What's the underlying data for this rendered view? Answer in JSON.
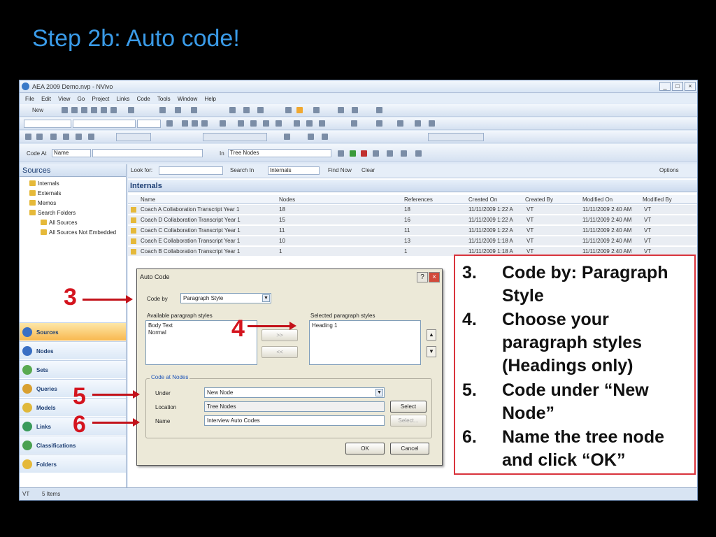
{
  "slide": {
    "title": "Step 2b: Auto code!"
  },
  "window": {
    "title": "AEA 2009 Demo.nvp - NVivo",
    "min": "_",
    "max": "□",
    "close": "×"
  },
  "menu": [
    "File",
    "Edit",
    "View",
    "Go",
    "Project",
    "Links",
    "Code",
    "Tools",
    "Window",
    "Help"
  ],
  "toolbar": {
    "new_label": "New",
    "code_at_label": "Code At",
    "code_at_value": "Name",
    "in_label": "In",
    "in_value": "Tree Nodes"
  },
  "sidebar": {
    "title": "Sources",
    "tree": [
      "Internals",
      "Externals",
      "Memos",
      "Search Folders",
      "All Sources",
      "All Sources Not Embedded"
    ],
    "nav": [
      "Sources",
      "Nodes",
      "Sets",
      "Queries",
      "Models",
      "Links",
      "Classifications",
      "Folders"
    ]
  },
  "findbar": {
    "look_for": "Look for:",
    "search_in": "Search In",
    "search_in_value": "Internals",
    "find_now": "Find Now",
    "clear": "Clear",
    "options": "Options"
  },
  "list": {
    "title": "Internals",
    "columns": [
      "Name",
      "Nodes",
      "References",
      "Created On",
      "Created By",
      "Modified On",
      "Modified By"
    ],
    "rows": [
      [
        "Coach A Collaboration Transcript Year 1",
        "18",
        "18",
        "11/11/2009 1:22 A",
        "VT",
        "11/11/2009 2:40 AM",
        "VT"
      ],
      [
        "Coach D Collaboration Transcript Year 1",
        "15",
        "16",
        "11/11/2009 1:22 A",
        "VT",
        "11/11/2009 2:40 AM",
        "VT"
      ],
      [
        "Coach C Collaboration Transcript Year 1",
        "11",
        "11",
        "11/11/2009 1:22 A",
        "VT",
        "11/11/2009 2:40 AM",
        "VT"
      ],
      [
        "Coach E Collaboration Transcript Year 1",
        "10",
        "13",
        "11/11/2009 1:18 A",
        "VT",
        "11/11/2009 2:40 AM",
        "VT"
      ],
      [
        "Coach B Collaboration Transcript Year 1",
        "1",
        "1",
        "11/11/2009 1:18 A",
        "VT",
        "11/11/2009 2:40 AM",
        "VT"
      ]
    ]
  },
  "dialog": {
    "title": "Auto Code",
    "help": "?",
    "close": "×",
    "code_by_label": "Code by",
    "code_by_value": "Paragraph Style",
    "available_label": "Available paragraph styles",
    "available": [
      "Body Text",
      "Normal"
    ],
    "selected_label": "Selected paragraph styles",
    "selected": [
      "Heading 1"
    ],
    "add": ">>",
    "remove": "<<",
    "up": "▲",
    "down": "▼",
    "group_title": "Code at Nodes",
    "under_label": "Under",
    "under_value": "New Node",
    "location_label": "Location",
    "location_value": "Tree Nodes",
    "name_label": "Name",
    "name_value": "Interview Auto Codes",
    "select_1": "Select",
    "select_2": "Select...",
    "ok": "OK",
    "cancel": "Cancel"
  },
  "callouts": [
    "3",
    "4",
    "5",
    "6"
  ],
  "notes": [
    {
      "num": "3.",
      "text": "Code by: Paragraph Style"
    },
    {
      "num": "4.",
      "text": "Choose your paragraph styles (Headings only)"
    },
    {
      "num": "5.",
      "text": "Code under “New Node”"
    },
    {
      "num": "6.",
      "text": "Name the tree node and click “OK”"
    }
  ],
  "status": {
    "user": "VT",
    "items": "5 Items"
  }
}
